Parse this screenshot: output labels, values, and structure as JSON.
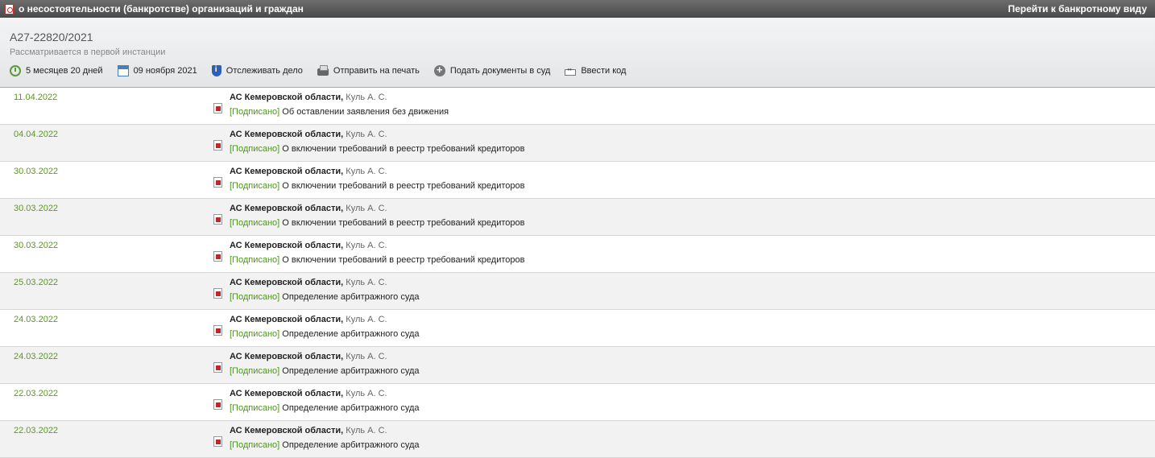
{
  "topbar": {
    "title": "о несостоятельности (банкротстве) организаций и граждан",
    "right_link": "Перейти к банкротному виду"
  },
  "case": {
    "number": "А27-22820/2021",
    "status": "Рассматривается в первой инстанции"
  },
  "toolbar": {
    "duration": "5 месяцев 20 дней",
    "date": "09 ноября 2021",
    "track": "Отслеживать дело",
    "print": "Отправить на печать",
    "submit": "Подать документы в суд",
    "code": "Ввести код"
  },
  "rows": [
    {
      "date": "11.04.2022",
      "court": "АС Кемеровской области,",
      "judge": " Куль А. С.",
      "signed": "[Подписано]",
      "doc": " Об оставлении заявления без движения"
    },
    {
      "date": "04.04.2022",
      "court": "АС Кемеровской области,",
      "judge": " Куль А. С.",
      "signed": "[Подписано]",
      "doc": " О включении требований в реестр требований кредиторов"
    },
    {
      "date": "30.03.2022",
      "court": "АС Кемеровской области,",
      "judge": " Куль А. С.",
      "signed": "[Подписано]",
      "doc": " О включении требований в реестр требований кредиторов"
    },
    {
      "date": "30.03.2022",
      "court": "АС Кемеровской области,",
      "judge": " Куль А. С.",
      "signed": "[Подписано]",
      "doc": " О включении требований в реестр требований кредиторов"
    },
    {
      "date": "30.03.2022",
      "court": "АС Кемеровской области,",
      "judge": " Куль А. С.",
      "signed": "[Подписано]",
      "doc": " О включении требований в реестр требований кредиторов"
    },
    {
      "date": "25.03.2022",
      "court": "АС Кемеровской области,",
      "judge": " Куль А. С.",
      "signed": "[Подписано]",
      "doc": " Определение арбитражного суда"
    },
    {
      "date": "24.03.2022",
      "court": "АС Кемеровской области,",
      "judge": " Куль А. С.",
      "signed": "[Подписано]",
      "doc": " Определение арбитражного суда"
    },
    {
      "date": "24.03.2022",
      "court": "АС Кемеровской области,",
      "judge": " Куль А. С.",
      "signed": "[Подписано]",
      "doc": " Определение арбитражного суда"
    },
    {
      "date": "22.03.2022",
      "court": "АС Кемеровской области,",
      "judge": " Куль А. С.",
      "signed": "[Подписано]",
      "doc": " Определение арбитражного суда"
    },
    {
      "date": "22.03.2022",
      "court": "АС Кемеровской области,",
      "judge": " Куль А. С.",
      "signed": "[Подписано]",
      "doc": " Определение арбитражного суда"
    }
  ]
}
